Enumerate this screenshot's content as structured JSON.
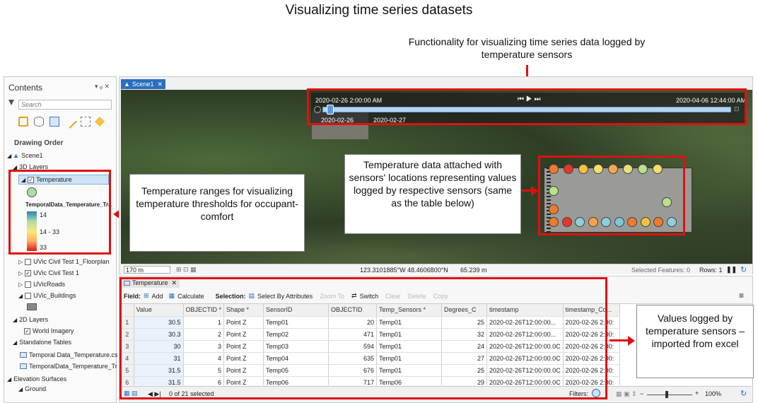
{
  "page_title": "Visualizing time series datasets",
  "annotations": {
    "time_slider": "Functionality for visualizing time series data logged by temperature sensors",
    "sensor_points": "Temperature data attached with sensors' locations representing values logged by respective sensors (same as the table below)",
    "ranges": "Temperature ranges for visualizing temperature thresholds for occupant-comfort",
    "values_logged": "Values logged by temperature sensors – imported from excel"
  },
  "contents_pane": {
    "title": "Contents",
    "search_placeholder": "Search",
    "drawing_order": "Drawing Order",
    "scene": "Scene1",
    "layers_3d": "3D Layers",
    "temperature_layer": "Temperature",
    "renderer_field": "TemporalData_Temperature_Tra",
    "legend": [
      {
        "label": "14",
        "color": "#2b83ba"
      },
      {
        "label": "14 - 33",
        "color": "#f7e87a"
      },
      {
        "label": "33",
        "color": "#d7191c"
      }
    ],
    "other_layers": [
      "UVic Civil Test 1_Floorplan",
      "UVic Civil Test 1",
      "UVicRoads",
      "UVic_Buildings"
    ],
    "layers_2d": "2D Layers",
    "world_imagery": "World Imagery",
    "standalone_tables": "Standalone Tables",
    "tables": [
      "Temporal Data_Temperature.cs",
      "TemporalData_Temperature_Tr"
    ],
    "elevation_surfaces": "Elevation Surfaces",
    "ground": "Ground"
  },
  "scene_tab": "Scene1",
  "time_slider": {
    "start": "2020-02-26 2:00:00 AM",
    "end": "2020-04-06 12:44:00 AM",
    "tick1": "2020-02-26",
    "tick2": "2020-02-27"
  },
  "status_bar": {
    "scale": "170 m",
    "coords": "123.3101885°W 48.4606800°N",
    "elevation": "65.239 m",
    "selected": "Selected Features: 0",
    "rows": "Rows: 1"
  },
  "table_view": {
    "tab": "Temperature",
    "field_label": "Field:",
    "add": "Add",
    "calculate": "Calculate",
    "selection_label": "Selection:",
    "select_by_attr": "Select By Attributes",
    "zoom_to": "Zoom To",
    "switch": "Switch",
    "clear": "Clear",
    "delete": "Delete",
    "copy": "Copy",
    "columns": [
      "Value",
      "OBJECTID *",
      "Shape *",
      "SensorID",
      "OBJECTID",
      "Temp_Sensors *",
      "Degrees_C",
      "timestamp",
      "timestamp_Co..."
    ],
    "rows": [
      [
        "1",
        "30.5",
        "1",
        "Point Z",
        "Temp01",
        "20",
        "Temp01",
        "25",
        "2020-02-26T12:00:00...",
        "2020-02-26 2:00:"
      ],
      [
        "2",
        "30.3",
        "2",
        "Point Z",
        "Temp02",
        "471",
        "Temp01",
        "32",
        "2020-02-26T12:00:00...",
        "2020-02-26 2:00:"
      ],
      [
        "3",
        "30",
        "3",
        "Point Z",
        "Temp03",
        "594",
        "Temp01",
        "24",
        "2020-02-26T12:00:00.0C",
        "2020-02-26 2:00:"
      ],
      [
        "4",
        "31",
        "4",
        "Point Z",
        "Temp04",
        "635",
        "Temp01",
        "27",
        "2020-02-26T12:00:00.0C",
        "2020-02-26 2:00:"
      ],
      [
        "5",
        "31.5",
        "5",
        "Point Z",
        "Temp05",
        "676",
        "Temp01",
        "25",
        "2020-02-26T12:00:00.0C",
        "2020-02-26 2:00:"
      ],
      [
        "6",
        "31.5",
        "6",
        "Point Z",
        "Temp06",
        "717",
        "Temp06",
        "29",
        "2020-02-26T12:00:00.0C",
        "2020-02-26 2:00:"
      ]
    ],
    "selected_text": "0 of 21 selected",
    "filters": "Filters:",
    "zoom": "100%"
  },
  "sensor_colors": {
    "top": [
      "#f07a2a",
      "#e8352a",
      "#f9c23c",
      "#f6e06a",
      "#f8a94a",
      "#e8e07a",
      "#b9e08a",
      "#f2dd6a"
    ],
    "left": [
      "#b9e08a"
    ],
    "left2": [
      "#f07a2a"
    ],
    "right": [
      "#b9e08a"
    ],
    "bottom": [
      "#f07a2a",
      "#e8352a",
      "#8fcfd8",
      "#f7a24a",
      "#8fcfd8",
      "#7fc6d8",
      "#f07a2a",
      "#f9c23c",
      "#f07a2a",
      "#8fcfd8"
    ]
  }
}
